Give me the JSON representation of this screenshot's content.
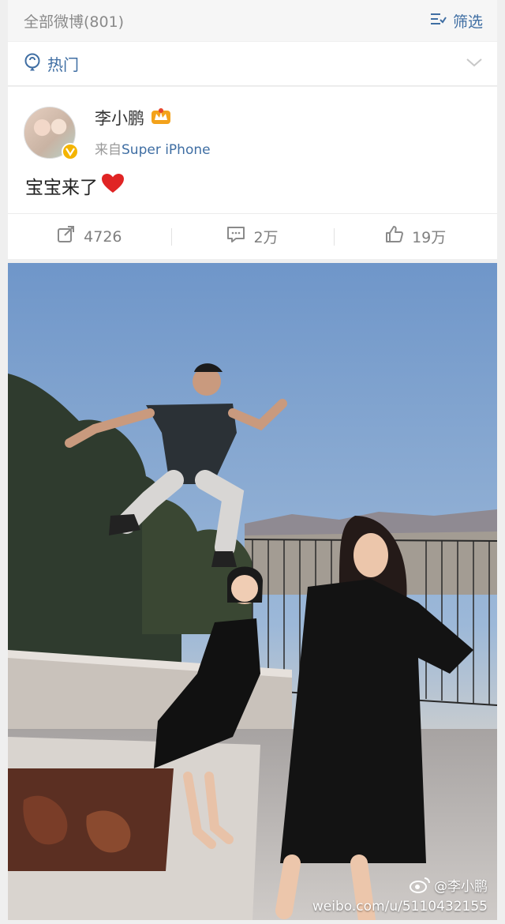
{
  "header": {
    "title": "全部微博(801)",
    "filter_label": "筛选",
    "filter_icon": "filter-icon"
  },
  "hot_section": {
    "label": "热门",
    "icon": "location-pin-icon",
    "expand_icon": "chevron-down-icon"
  },
  "post": {
    "author": "李小鹏",
    "source_prefix": "来自",
    "source_device": "Super iPhone",
    "text": "宝宝来了",
    "verified_badge": "verified-v-icon",
    "emoji": "red-heart-icon",
    "actions": [
      {
        "name": "repost",
        "count": "4726",
        "icon": "repost-icon"
      },
      {
        "name": "comment",
        "count": "2万",
        "icon": "comment-icon"
      },
      {
        "name": "like",
        "count": "19万",
        "icon": "thumbs-up-icon"
      }
    ]
  },
  "photo": {
    "watermark_handle": "@李小鹏",
    "watermark_url": "weibo.com/u/5110432155"
  },
  "colors": {
    "link_blue": "#3f6ea3",
    "muted_gray": "#8a8a8a",
    "badge_gold": "#f4b400",
    "heart_red": "#e02424"
  }
}
